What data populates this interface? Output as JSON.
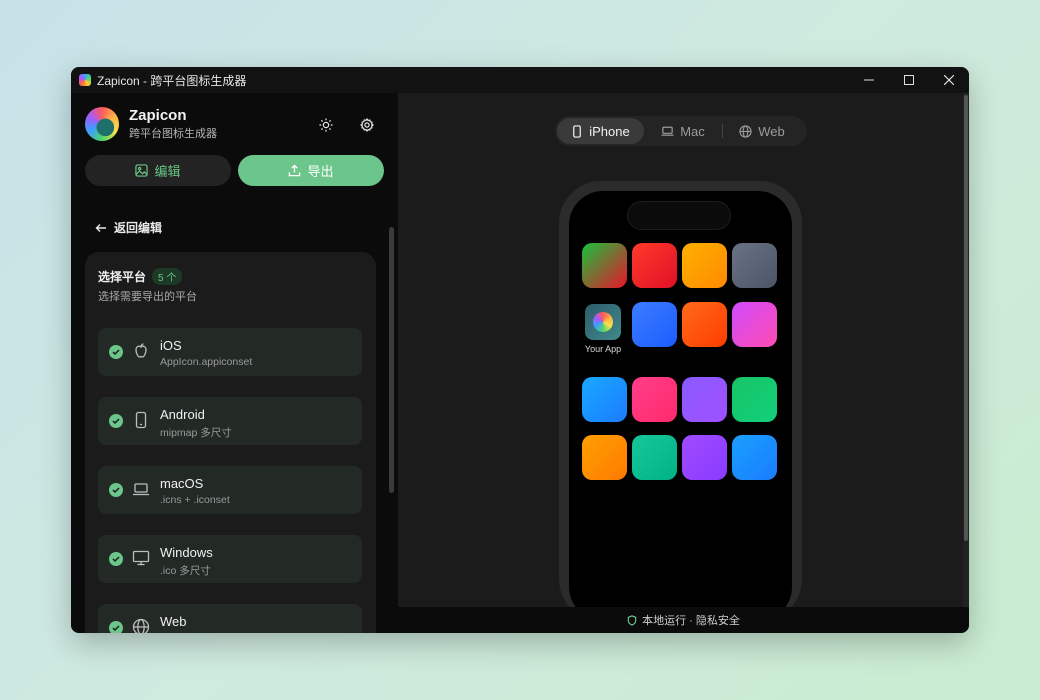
{
  "window": {
    "title": "Zapicon - 跨平台图标生成器",
    "controls": {
      "minimize": "─",
      "maximize": "☐",
      "close": "✕"
    }
  },
  "sidebar": {
    "brand_name": "Zapicon",
    "brand_subtitle": "跨平台图标生成器",
    "edit_tab": "编辑",
    "export_tab": "导出",
    "back_link": "返回编辑",
    "panel": {
      "title": "选择平台",
      "count": "5 个",
      "subtitle": "选择需要导出的平台",
      "platforms": [
        {
          "name": "iOS",
          "desc": "AppIcon.appiconset",
          "icon": "apple-icon",
          "checked": true
        },
        {
          "name": "Android",
          "desc": "mipmap 多尺寸",
          "icon": "phone-icon",
          "checked": true
        },
        {
          "name": "macOS",
          "desc": ".icns + .iconset",
          "icon": "laptop-icon",
          "checked": true
        },
        {
          "name": "Windows",
          "desc": ".ico 多尺寸",
          "icon": "monitor-icon",
          "checked": true
        },
        {
          "name": "Web",
          "desc": "",
          "icon": "globe-icon",
          "checked": true
        }
      ]
    }
  },
  "preview": {
    "tabs": [
      {
        "label": "iPhone",
        "icon": "phone-icon",
        "active": true
      },
      {
        "label": "Mac",
        "icon": "laptop-icon",
        "active": false
      },
      {
        "label": "Web",
        "icon": "globe-icon",
        "active": false
      }
    ],
    "your_app_label": "Your App",
    "app_colors": [
      [
        "#18c23c",
        "#e8142a"
      ],
      [
        "#ff3a2b",
        "#e01026"
      ],
      [
        "#ffb000",
        "#ff8a00"
      ],
      [
        "#6a7385",
        "#4c5566"
      ],
      [
        "#3a7dff",
        "#1d5cff"
      ],
      [
        "#ff6a1a",
        "#ff3d00"
      ],
      [
        "#d04bff",
        "#ff4bb0"
      ],
      [
        "#1aa8ff",
        "#1b7cff"
      ],
      [
        "#ff3d8b",
        "#ff2a6b"
      ],
      [
        "#8a5bff",
        "#a050ff"
      ],
      [
        "#18c466",
        "#10d07a"
      ],
      [
        "#ffa000",
        "#ff7a00"
      ],
      [
        "#16c79a",
        "#00b386"
      ],
      [
        "#a04bff",
        "#8a3bff"
      ],
      [
        "#1aa0ff",
        "#1a7cff"
      ]
    ]
  },
  "status": {
    "text": "本地运行 · 隐私安全"
  },
  "colors": {
    "accent": "#6cc58a",
    "bg": "#0b0b0b",
    "panel": "#1b1b1b"
  }
}
